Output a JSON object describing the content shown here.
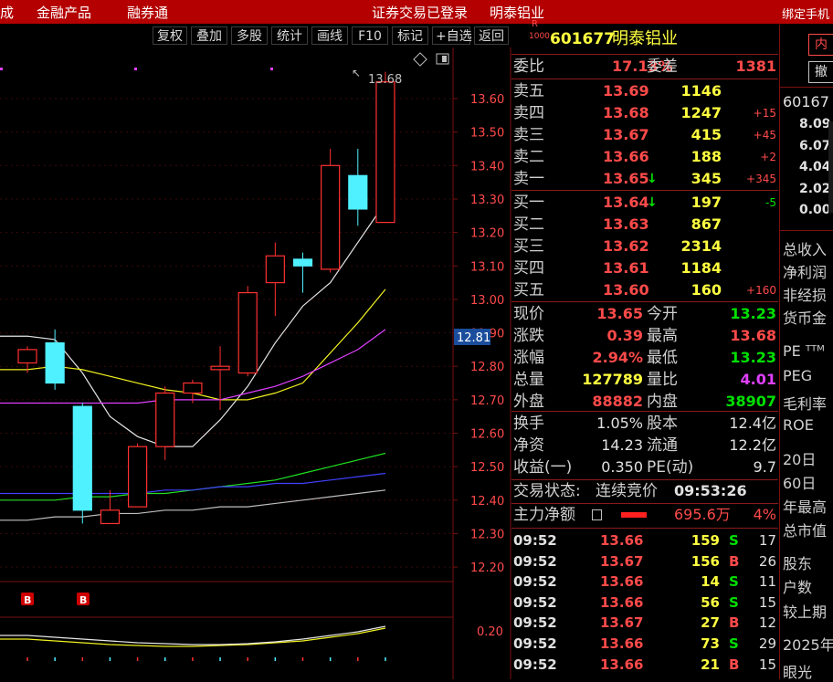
{
  "menubar": {
    "item1": "成",
    "item2": "金融产品",
    "item3": "融券通",
    "login_status": "证券交易已登录",
    "stock_name": "明泰铝业",
    "bind_phone": "绑定手机"
  },
  "toolbar": [
    "复权",
    "叠加",
    "多股",
    "统计",
    "画线",
    "F10",
    "标记",
    "+自选",
    "返回"
  ],
  "chart": {
    "price_labels": [
      "13.60",
      "13.50",
      "13.40",
      "13.30",
      "13.20",
      "13.10",
      "13.00",
      "12.90",
      "12.80",
      "12.70",
      "12.60",
      "12.50",
      "12.40",
      "12.30",
      "12.20"
    ],
    "price_ticks": [
      13.6,
      13.5,
      13.4,
      13.3,
      13.2,
      13.1,
      13.0,
      12.9,
      12.8,
      12.7,
      12.6,
      12.5,
      12.4,
      12.3,
      12.2
    ],
    "current_price_label": "12.81",
    "current_price": 12.81,
    "high_marker": "13.68",
    "b_marker": "B",
    "indicator_label": "0.20",
    "candles": [
      {
        "o": 12.85,
        "c": 12.81,
        "h": 12.86,
        "l": 12.78,
        "up": true
      },
      {
        "o": 12.87,
        "c": 12.75,
        "h": 12.91,
        "l": 12.73,
        "up": false
      },
      {
        "o": 12.68,
        "c": 12.37,
        "h": 12.69,
        "l": 12.33,
        "up": false
      },
      {
        "o": 12.33,
        "c": 12.37,
        "h": 12.43,
        "l": 12.33,
        "up": true
      },
      {
        "o": 12.38,
        "c": 12.56,
        "h": 12.57,
        "l": 12.38,
        "up": true
      },
      {
        "o": 12.56,
        "c": 12.72,
        "h": 12.74,
        "l": 12.52,
        "up": true
      },
      {
        "o": 12.72,
        "c": 12.75,
        "h": 12.76,
        "l": 12.69,
        "up": true
      },
      {
        "o": 12.79,
        "c": 12.8,
        "h": 12.86,
        "l": 12.67,
        "up": true
      },
      {
        "o": 12.78,
        "c": 13.02,
        "h": 13.04,
        "l": 12.77,
        "up": true
      },
      {
        "o": 13.05,
        "c": 13.13,
        "h": 13.17,
        "l": 12.95,
        "up": true
      },
      {
        "o": 13.12,
        "c": 13.1,
        "h": 13.14,
        "l": 13.02,
        "up": false
      },
      {
        "o": 13.09,
        "c": 13.4,
        "h": 13.45,
        "l": 13.08,
        "up": true
      },
      {
        "o": 13.37,
        "c": 13.27,
        "h": 13.45,
        "l": 13.22,
        "up": false
      },
      {
        "o": 13.23,
        "c": 13.65,
        "h": 13.68,
        "l": 13.23,
        "up": true
      }
    ],
    "ma_white": [
      12.89,
      12.88,
      12.78,
      12.65,
      12.59,
      12.56,
      12.56,
      12.64,
      12.74,
      12.87,
      12.98,
      13.05,
      13.17,
      13.29
    ],
    "ma_yellow": [
      12.79,
      12.8,
      12.79,
      12.77,
      12.75,
      12.73,
      12.72,
      12.7,
      12.7,
      12.72,
      12.75,
      12.84,
      12.93,
      13.03
    ],
    "ma_magenta": [
      12.69,
      12.69,
      12.69,
      12.69,
      12.69,
      12.7,
      12.7,
      12.7,
      12.72,
      12.74,
      12.77,
      12.81,
      12.85,
      12.91
    ],
    "ma_green": [
      12.4,
      12.4,
      12.41,
      12.41,
      12.42,
      12.42,
      12.43,
      12.44,
      12.45,
      12.46,
      12.48,
      12.5,
      12.52,
      12.54
    ],
    "ma_blue": [
      12.42,
      12.42,
      12.42,
      12.42,
      12.42,
      12.43,
      12.43,
      12.44,
      12.44,
      12.45,
      12.45,
      12.46,
      12.47,
      12.48
    ],
    "ma_gray": [
      12.34,
      12.35,
      12.35,
      12.36,
      12.36,
      12.37,
      12.37,
      12.38,
      12.38,
      12.39,
      12.4,
      12.41,
      12.42,
      12.43
    ]
  },
  "quote": {
    "badge_r": "R",
    "badge_num": "1000",
    "code": "601677",
    "name": "明泰铝业",
    "weibi_label": "委比",
    "weibi": "17.13%",
    "weicha_label": "委差",
    "weicha": "1381",
    "asks": [
      {
        "label": "卖五",
        "price": "13.69",
        "vol": "1146",
        "chg": "",
        "arrow": ""
      },
      {
        "label": "卖四",
        "price": "13.68",
        "vol": "1247",
        "chg": "+15",
        "arrow": ""
      },
      {
        "label": "卖三",
        "price": "13.67",
        "vol": "415",
        "chg": "+45",
        "arrow": ""
      },
      {
        "label": "卖二",
        "price": "13.66",
        "vol": "188",
        "chg": "+2",
        "arrow": ""
      },
      {
        "label": "卖一",
        "price": "13.65",
        "vol": "345",
        "chg": "+345",
        "arrow": "↓"
      }
    ],
    "bids": [
      {
        "label": "买一",
        "price": "13.64",
        "vol": "197",
        "chg": "-5",
        "arrow": "↓"
      },
      {
        "label": "买二",
        "price": "13.63",
        "vol": "867",
        "chg": "",
        "arrow": ""
      },
      {
        "label": "买三",
        "price": "13.62",
        "vol": "2314",
        "chg": "",
        "arrow": ""
      },
      {
        "label": "买四",
        "price": "13.61",
        "vol": "1184",
        "chg": "",
        "arrow": ""
      },
      {
        "label": "买五",
        "price": "13.60",
        "vol": "160",
        "chg": "+160",
        "arrow": ""
      }
    ],
    "stats": [
      {
        "l1": "现价",
        "v1": "13.65",
        "c1": "r",
        "l2": "今开",
        "v2": "13.23",
        "c2": "g"
      },
      {
        "l1": "涨跌",
        "v1": "0.39",
        "c1": "r",
        "l2": "最高",
        "v2": "13.68",
        "c2": "r"
      },
      {
        "l1": "涨幅",
        "v1": "2.94%",
        "c1": "r",
        "l2": "最低",
        "v2": "13.23",
        "c2": "g"
      },
      {
        "l1": "总量",
        "v1": "127789",
        "c1": "y",
        "l2": "量比",
        "v2": "4.01",
        "c2": "m"
      },
      {
        "l1": "外盘",
        "v1": "88882",
        "c1": "r",
        "l2": "内盘",
        "v2": "38907",
        "c2": "g"
      }
    ],
    "stats2": [
      {
        "l1": "换手",
        "v1": "1.05%",
        "l2": "股本",
        "v2": "12.4亿"
      },
      {
        "l1": "净资",
        "v1": "14.23",
        "l2": "流通",
        "v2": "12.2亿"
      },
      {
        "l1": "收益(一)",
        "v1": "0.350",
        "l2": "PE(动)",
        "v2": "9.7"
      }
    ],
    "trade_status_label": "交易状态:",
    "trade_status": "连续竞价",
    "trade_time": "09:53:26",
    "main_flow_label": "主力净额",
    "main_flow_value": "695.6万",
    "main_flow_pct": "4%",
    "ticks": [
      {
        "t": "09:52",
        "p": "13.66",
        "v": "159",
        "s": "S",
        "n": "17"
      },
      {
        "t": "09:52",
        "p": "13.67",
        "v": "156",
        "s": "B",
        "n": "26"
      },
      {
        "t": "09:52",
        "p": "13.66",
        "v": "14",
        "s": "S",
        "n": "11"
      },
      {
        "t": "09:52",
        "p": "13.66",
        "v": "56",
        "s": "S",
        "n": "15"
      },
      {
        "t": "09:52",
        "p": "13.67",
        "v": "27",
        "s": "B",
        "n": "12"
      },
      {
        "t": "09:52",
        "p": "13.66",
        "v": "73",
        "s": "S",
        "n": "29"
      },
      {
        "t": "09:52",
        "p": "13.66",
        "v": "21",
        "s": "B",
        "n": "15"
      }
    ]
  },
  "rightpanel": {
    "btn1": "内",
    "btn2": "撤",
    "code": "60167",
    "axis": [
      "8.09",
      "6.07",
      "4.04",
      "2.02",
      "0.00"
    ],
    "fin": [
      "总收入",
      "净利润",
      "非经损",
      "货币金",
      "PE ᵀᵀᴹ",
      "PEG",
      "毛利率",
      "ROE",
      "20日",
      "60日",
      "年最高",
      "总市值",
      "股东",
      "户数",
      "较上期",
      "2025年",
      "眼光"
    ]
  }
}
